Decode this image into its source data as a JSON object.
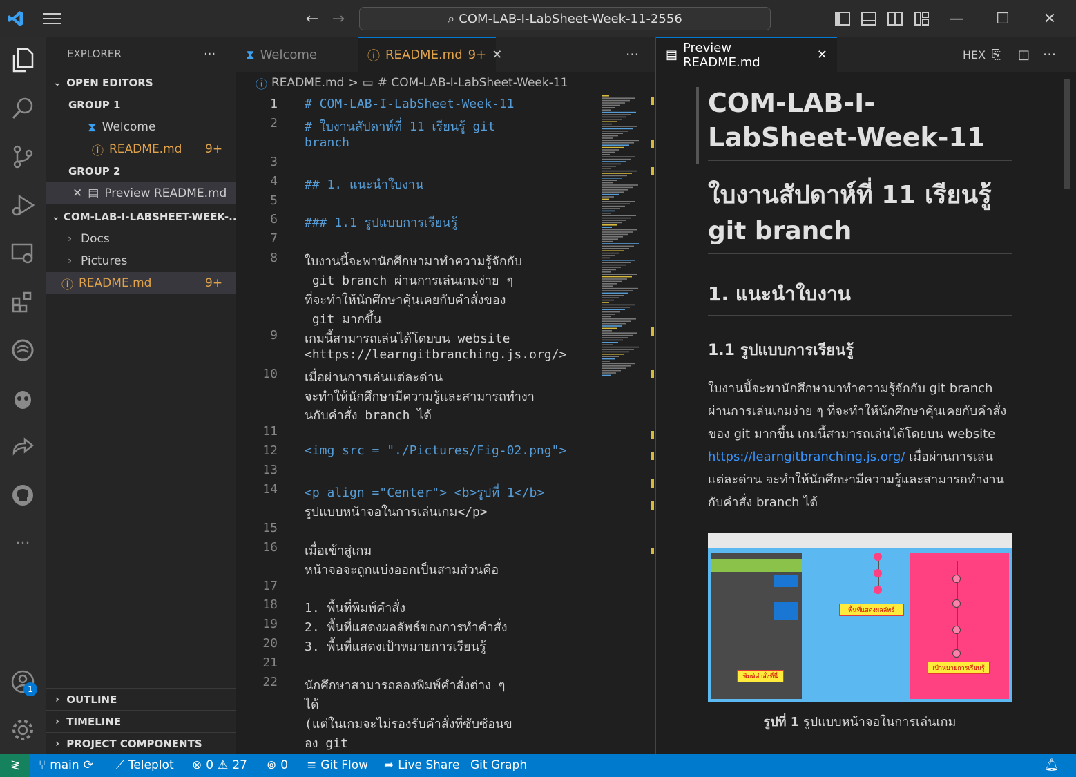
{
  "titlebar": {
    "command_center": "COM-LAB-I-LabSheet-Week-11-2556"
  },
  "sidebar": {
    "title": "EXPLORER",
    "more": "···",
    "open_editors": "OPEN EDITORS",
    "group1": "GROUP 1",
    "g1_items": [
      {
        "label": "Welcome"
      },
      {
        "label": "README.md",
        "badge": "9+"
      }
    ],
    "group2": "GROUP 2",
    "g2_items": [
      {
        "label": "Preview README.md"
      }
    ],
    "folder": "COM-LAB-I-LABSHEET-WEEK-...",
    "folder_items": [
      {
        "label": "Docs"
      },
      {
        "label": "Pictures"
      },
      {
        "label": "README.md",
        "badge": "9+"
      }
    ],
    "panels": [
      "OUTLINE",
      "TIMELINE",
      "PROJECT COMPONENTS"
    ],
    "account_badge": "1"
  },
  "editor": {
    "tabs": [
      {
        "label": "Welcome"
      },
      {
        "label": "README.md",
        "badge": "9+"
      }
    ],
    "more": "···",
    "breadcrumb": [
      "README.md",
      ">",
      "# COM-LAB-I-LabSheet-Week-11"
    ],
    "lines": [
      {
        "n": "1",
        "text": "# COM-LAB-I-LabSheet-Week-11",
        "color": "#569cd6",
        "current": true
      },
      {
        "n": "2",
        "text": "# ใบงานสัปดาห์ที่ 11 เรียนรู้ git",
        "color": "#569cd6"
      },
      {
        "n": "",
        "text": "branch",
        "color": "#569cd6"
      },
      {
        "n": "3",
        "text": "",
        "color": "#ccc"
      },
      {
        "n": "4",
        "text": "## 1. แนะนำใบงาน",
        "color": "#569cd6"
      },
      {
        "n": "5",
        "text": "",
        "color": "#ccc"
      },
      {
        "n": "6",
        "text": "### 1.1 รูปแบบการเรียนรู้",
        "color": "#569cd6"
      },
      {
        "n": "7",
        "text": "",
        "color": "#ccc"
      },
      {
        "n": "8",
        "text": "ใบงานนี้จะพานักศึกษามาทำความรู้จักกับ",
        "color": "#d4d4d4"
      },
      {
        "n": "",
        "text": " git branch ผ่านการเล่นเกมง่าย ๆ",
        "color": "#d4d4d4"
      },
      {
        "n": "",
        "text": "ที่จะทำให้นักศึกษาคุ้นเคยกับคำสั่งของ",
        "color": "#d4d4d4"
      },
      {
        "n": "",
        "text": " git มากขึ้น",
        "color": "#d4d4d4"
      },
      {
        "n": "9",
        "text": "เกมนี้สามารถเล่นได้โดยบน website",
        "color": "#d4d4d4"
      },
      {
        "n": "",
        "text": "<https://learngitbranching.js.org/>",
        "color": "#d4d4d4"
      },
      {
        "n": "10",
        "text": "เมื่อผ่านการเล่นแต่ละด่าน",
        "color": "#d4d4d4"
      },
      {
        "n": "",
        "text": "จะทำให้นักศึกษามีความรู้และสามารถทำงา",
        "color": "#d4d4d4"
      },
      {
        "n": "",
        "text": "นกับคำสั่ง branch ได้",
        "color": "#d4d4d4"
      },
      {
        "n": "11",
        "text": "",
        "color": "#ccc"
      },
      {
        "n": "12",
        "text": "<img src = \"./Pictures/Fig-02.png\">",
        "color": "#569cd6"
      },
      {
        "n": "13",
        "text": "",
        "color": "#ccc"
      },
      {
        "n": "14",
        "text": "<p align =\"Center\"> <b>รูปที่ 1</b>",
        "color": "#569cd6"
      },
      {
        "n": "",
        "text": "รูปแบบหน้าจอในการเล่นเกม</p>",
        "color": "#d4d4d4"
      },
      {
        "n": "15",
        "text": "",
        "color": "#ccc"
      },
      {
        "n": "16",
        "text": "เมื่อเข้าสู่เกม",
        "color": "#d4d4d4"
      },
      {
        "n": "",
        "text": "หน้าจอจะถูกแบ่งออกเป็นสามส่วนคือ",
        "color": "#d4d4d4"
      },
      {
        "n": "17",
        "text": "",
        "color": "#ccc"
      },
      {
        "n": "18",
        "text": "1. พื้นที่พิมพ์คำสั่ง",
        "color": "#d4d4d4"
      },
      {
        "n": "19",
        "text": "2. พื้นที่แสดงผลลัพธ์ของการทำคำสั่ง",
        "color": "#d4d4d4"
      },
      {
        "n": "20",
        "text": "3. พื้นที่แสดงเป้าหมายการเรียนรู้",
        "color": "#d4d4d4"
      },
      {
        "n": "21",
        "text": "",
        "color": "#ccc"
      },
      {
        "n": "22",
        "text": "นักศึกษาสามารถลองพิมพ์คำสั่งต่าง ๆ",
        "color": "#d4d4d4"
      },
      {
        "n": "",
        "text": "ได้",
        "color": "#d4d4d4"
      },
      {
        "n": "",
        "text": "(แต่ในเกมจะไม่รองรับคำสั่งที่ซับซ้อนข",
        "color": "#d4d4d4"
      },
      {
        "n": "",
        "text": "อง git",
        "color": "#d4d4d4"
      }
    ]
  },
  "preview": {
    "tab": "Preview README.md",
    "hex": "HEX",
    "more": "···",
    "h1": "COM-LAB-I-LabSheet-Week-11",
    "h1b": "ใบงานสัปดาห์ที่ 11 เรียนรู้ git branch",
    "h2": "1. แนะนำใบงาน",
    "h3": "1.1 รูปแบบการเรียนรู้",
    "para1": "ใบงานนี้จะพานักศึกษามาทำความรู้จักกับ git branch ผ่านการเล่นเกมง่าย ๆ ที่จะทำให้นักศึกษาคุ้นเคยกับคำสั่งของ git มากขึ้น เกมนี้สามารถเล่นได้โดยบน website",
    "link": "https://learngitbranching.js.org/",
    "para2": "เมื่อผ่านการเล่นแต่ละด่าน จะทำให้นักศึกษามีความรู้และสามารถทำงานกับคำสั่ง branch ได้",
    "fig_label_bold": "รูปที่ 1",
    "fig_label": " รูปแบบหน้าจอในการเล่นเกม",
    "fig_tags": [
      "พิมพ์คำสั่งที่นี่",
      "พื้นที่แสดงผลลัพธ์",
      "เป้าหมายการเรียนรู้"
    ]
  },
  "status": {
    "branch": "main",
    "teleplot": "Teleplot",
    "errors": "0",
    "warnings": "27",
    "ports": "0",
    "gitflow": "Git Flow",
    "liveshare": "Live Share",
    "gitgraph": "Git Graph"
  },
  "colors": {
    "accent": "#007acc",
    "warning": "#e0a34b",
    "link": "#3794ff",
    "heading": "#569cd6"
  }
}
